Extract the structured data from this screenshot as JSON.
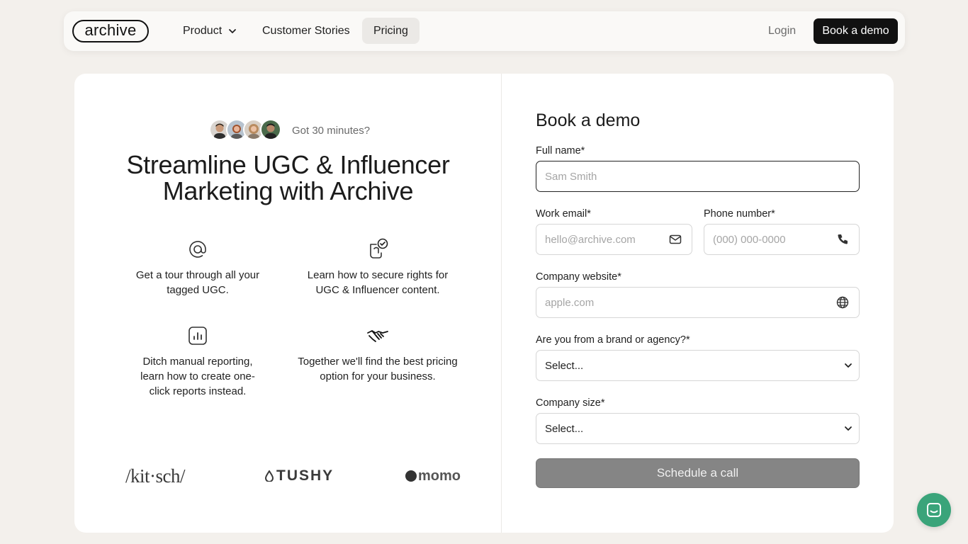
{
  "nav": {
    "logo_text": "archive",
    "items": [
      {
        "label": "Product"
      },
      {
        "label": "Customer Stories"
      },
      {
        "label": "Pricing"
      }
    ],
    "login_label": "Login",
    "cta_label": "Book a demo"
  },
  "hero": {
    "time_note": "Got 30 minutes?",
    "headline": "Streamline UGC & Influencer Marketing with Archive",
    "features": [
      {
        "text": "Get a tour through all your tagged UGC.",
        "icon": "at-sign-icon"
      },
      {
        "text": "Learn how to secure rights for UGC & Influencer content.",
        "icon": "rights-check-icon"
      },
      {
        "text": "Ditch manual reporting, learn how to create one-click reports instead.",
        "icon": "bar-chart-icon"
      },
      {
        "text": "Together we'll find the best pricing option for your business.",
        "icon": "handshake-icon"
      }
    ],
    "brands": [
      "/kit·sch/",
      "TUSHY",
      "momo"
    ]
  },
  "form": {
    "title": "Book a demo",
    "full_name": {
      "label": "Full name*",
      "placeholder": "Sam Smith"
    },
    "work_email": {
      "label": "Work email*",
      "placeholder": "hello@archive.com"
    },
    "phone": {
      "label": "Phone number*",
      "placeholder": "(000) 000-0000"
    },
    "website": {
      "label": "Company website*",
      "placeholder": "apple.com"
    },
    "brand_or_agency": {
      "label": "Are you from a brand or agency?*",
      "selected": "Select..."
    },
    "company_size": {
      "label": "Company size*",
      "selected": "Select..."
    },
    "submit_label": "Schedule a call"
  },
  "colors": {
    "background": "#f3f0ec",
    "primary": "#111111",
    "submit_disabled": "#858585",
    "chat_bubble": "#3aa47a"
  }
}
